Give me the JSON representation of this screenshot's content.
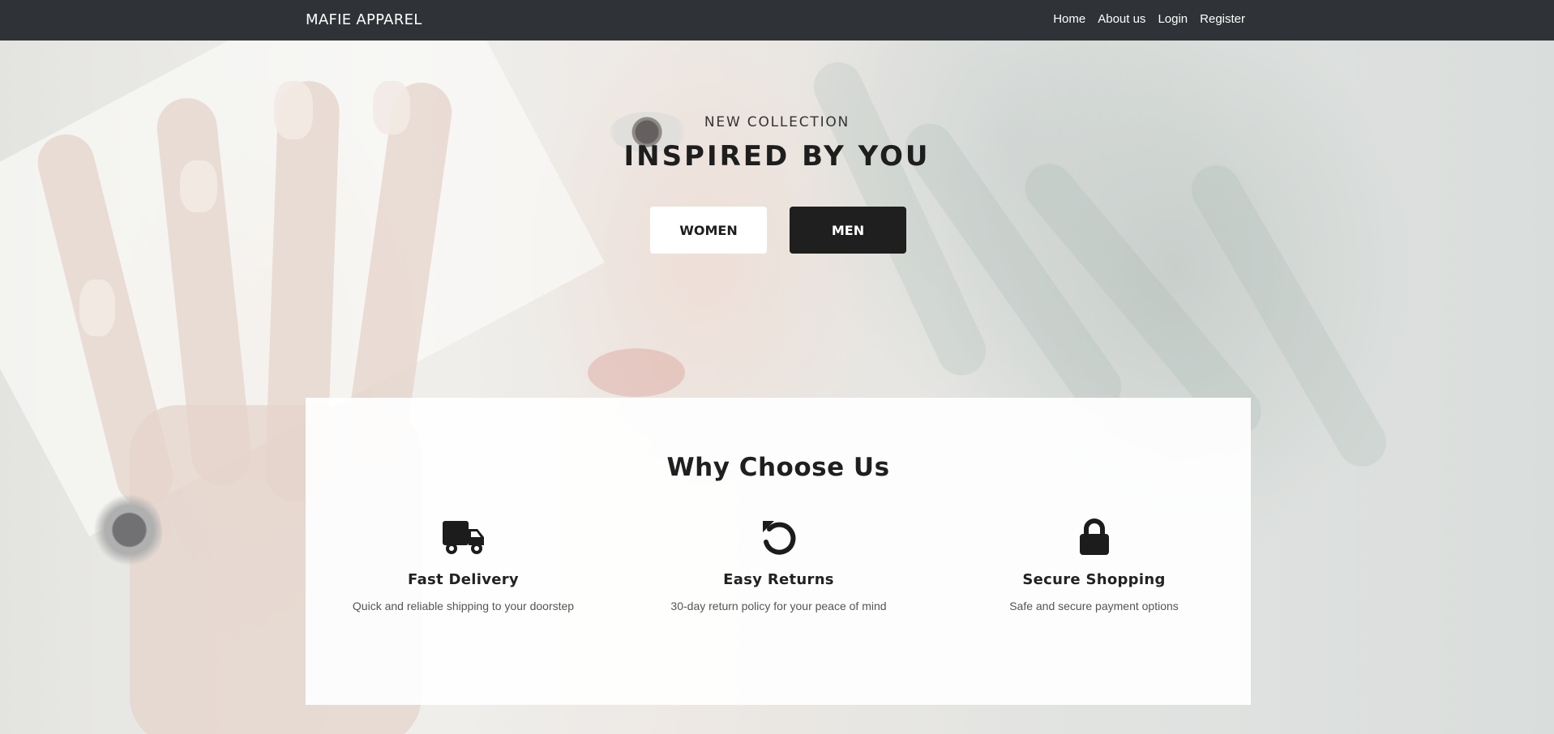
{
  "navbar": {
    "brand": "MAFIE APPAREL",
    "links": [
      "Home",
      "About us",
      "Login",
      "Register"
    ]
  },
  "hero": {
    "subtitle": "NEW COLLECTION",
    "title": "INSPIRED BY YOU",
    "buttons": {
      "women": "WOMEN",
      "men": "MEN"
    }
  },
  "features": {
    "title": "Why Choose Us",
    "items": [
      {
        "icon": "truck-icon",
        "title": "Fast Delivery",
        "text": "Quick and reliable shipping to your doorstep"
      },
      {
        "icon": "undo-icon",
        "title": "Easy Returns",
        "text": "30-day return policy for your peace of mind"
      },
      {
        "icon": "lock-icon",
        "title": "Secure Shopping",
        "text": "Safe and secure payment options"
      }
    ]
  },
  "colors": {
    "navbar_bg": "#2f3236",
    "dark_button": "#1f1f1f",
    "light_button": "#ffffff",
    "text_dark": "#1e1e1e"
  }
}
